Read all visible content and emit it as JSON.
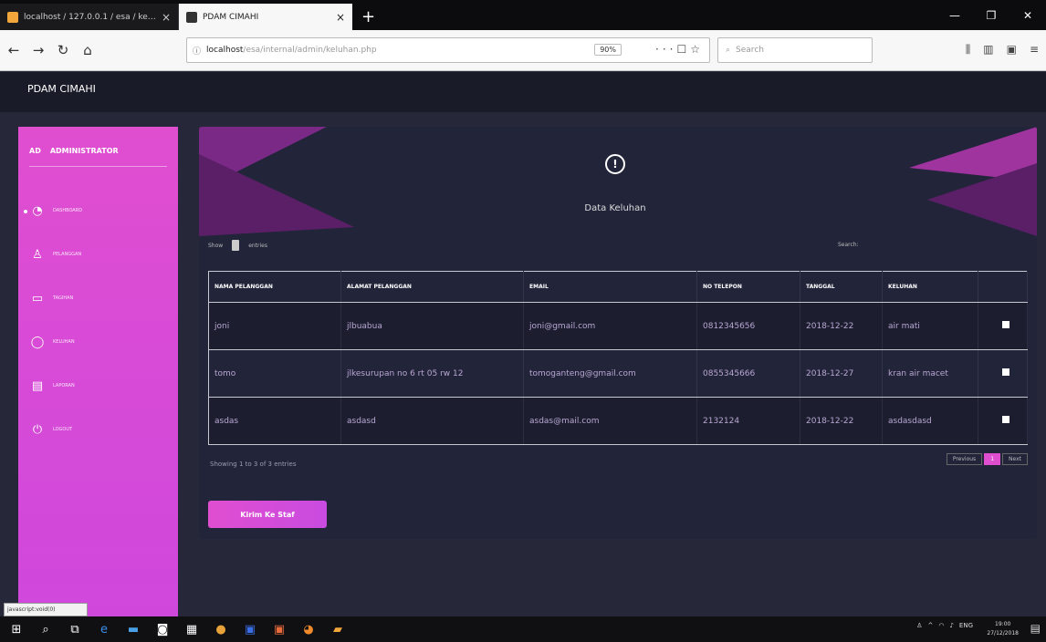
{
  "browser": {
    "tabs": [
      {
        "title": "localhost / 127.0.0.1 / esa / kel..."
      },
      {
        "title": "PDAM CIMAHI"
      }
    ],
    "url_host": "localhost",
    "url_path": "/esa/internal/admin/keluhan.php",
    "zoom": "90%",
    "search_placeholder": "Search",
    "status_text": "javascript:void(0)"
  },
  "app": {
    "brand": "PDAM CIMAHI",
    "sidebar": {
      "initials": "AD",
      "role": "ADMINISTRATOR",
      "items": [
        {
          "icon": "dashboard-icon",
          "label": "DASHBOARD"
        },
        {
          "icon": "user-icon",
          "label": "PELANGGAN"
        },
        {
          "icon": "calendar-icon",
          "label": "TAGIHAN"
        },
        {
          "icon": "chat-icon",
          "label": "KELUHAN"
        },
        {
          "icon": "report-icon",
          "label": "LAPORAN"
        },
        {
          "icon": "power-icon",
          "label": "LOGOUT"
        }
      ]
    },
    "card": {
      "title": "Data Keluhan",
      "show_label": "Show",
      "entries_label": "entries",
      "search_label": "Search:",
      "columns": [
        "NAMA PELANGGAN",
        "ALAMAT PELANGGAN",
        "EMAIL",
        "NO TELEPON",
        "TANGGAL",
        "KELUHAN",
        ""
      ],
      "rows": [
        [
          "joni",
          "jlbuabua",
          "joni@gmail.com",
          "0812345656",
          "2018-12-22",
          "air mati"
        ],
        [
          "tomo",
          "jlkesurupan no 6 rt 05 rw 12",
          "tomoganteng@gmail.com",
          "0855345666",
          "2018-12-27",
          "kran air macet"
        ],
        [
          "asdas",
          "asdasd",
          "asdas@mail.com",
          "2132124",
          "2018-12-22",
          "asdasdasd"
        ]
      ],
      "showing": "Showing 1 to 3 of 3 entries",
      "pager": {
        "prev": "Previous",
        "current": "1",
        "next": "Next"
      },
      "send_button": "Kirim Ke Staf"
    }
  },
  "taskbar": {
    "tray": "ENG",
    "time": "19:00",
    "date": "27/12/2018"
  },
  "colors": {
    "accent": "#e04ed0",
    "page_bg": "#26283a",
    "card_bg": "#22243a"
  }
}
